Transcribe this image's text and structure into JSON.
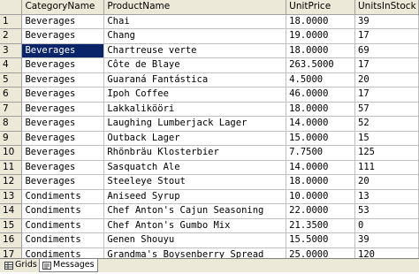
{
  "grid": {
    "columns": [
      "",
      "CategoryName",
      "ProductName",
      "UnitPrice",
      "UnitsInStock"
    ],
    "rows": [
      [
        "1",
        "Beverages",
        "Chai",
        "18.0000",
        "39"
      ],
      [
        "2",
        "Beverages",
        "Chang",
        "19.0000",
        "17"
      ],
      [
        "3",
        "Beverages",
        "Chartreuse verte",
        "18.0000",
        "69"
      ],
      [
        "4",
        "Beverages",
        "Côte de Blaye",
        "263.5000",
        "17"
      ],
      [
        "5",
        "Beverages",
        "Guaraná Fantástica",
        "4.5000",
        "20"
      ],
      [
        "6",
        "Beverages",
        "Ipoh Coffee",
        "46.0000",
        "17"
      ],
      [
        "7",
        "Beverages",
        "Lakkalikööri",
        "18.0000",
        "57"
      ],
      [
        "8",
        "Beverages",
        "Laughing Lumberjack Lager",
        "14.0000",
        "52"
      ],
      [
        "9",
        "Beverages",
        "Outback Lager",
        "15.0000",
        "15"
      ],
      [
        "10",
        "Beverages",
        "Rhönbräu Klosterbier",
        "7.7500",
        "125"
      ],
      [
        "11",
        "Beverages",
        "Sasquatch Ale",
        "14.0000",
        "111"
      ],
      [
        "12",
        "Beverages",
        "Steeleye Stout",
        "18.0000",
        "20"
      ],
      [
        "13",
        "Condiments",
        "Aniseed Syrup",
        "10.0000",
        "13"
      ],
      [
        "14",
        "Condiments",
        "Chef Anton's Cajun Seasoning",
        "22.0000",
        "53"
      ],
      [
        "15",
        "Condiments",
        "Chef Anton's Gumbo Mix",
        "21.3500",
        "0"
      ],
      [
        "16",
        "Condiments",
        "Genen Shouyu",
        "15.5000",
        "39"
      ],
      [
        "17",
        "Condiments",
        "Grandma's Boysenberry Spread",
        "25.0000",
        "120"
      ]
    ],
    "selected_row": 2,
    "selected_col": 1
  },
  "tabs": [
    {
      "label": "Grids",
      "icon": "grid-icon",
      "active": false
    },
    {
      "label": "Messages",
      "icon": "messages-icon",
      "active": true
    }
  ],
  "colors": {
    "header_bg": "#ece9d8",
    "selection_bg": "#0a246a",
    "selection_fg": "#ffffff",
    "gridline": "#c0c0c0"
  }
}
